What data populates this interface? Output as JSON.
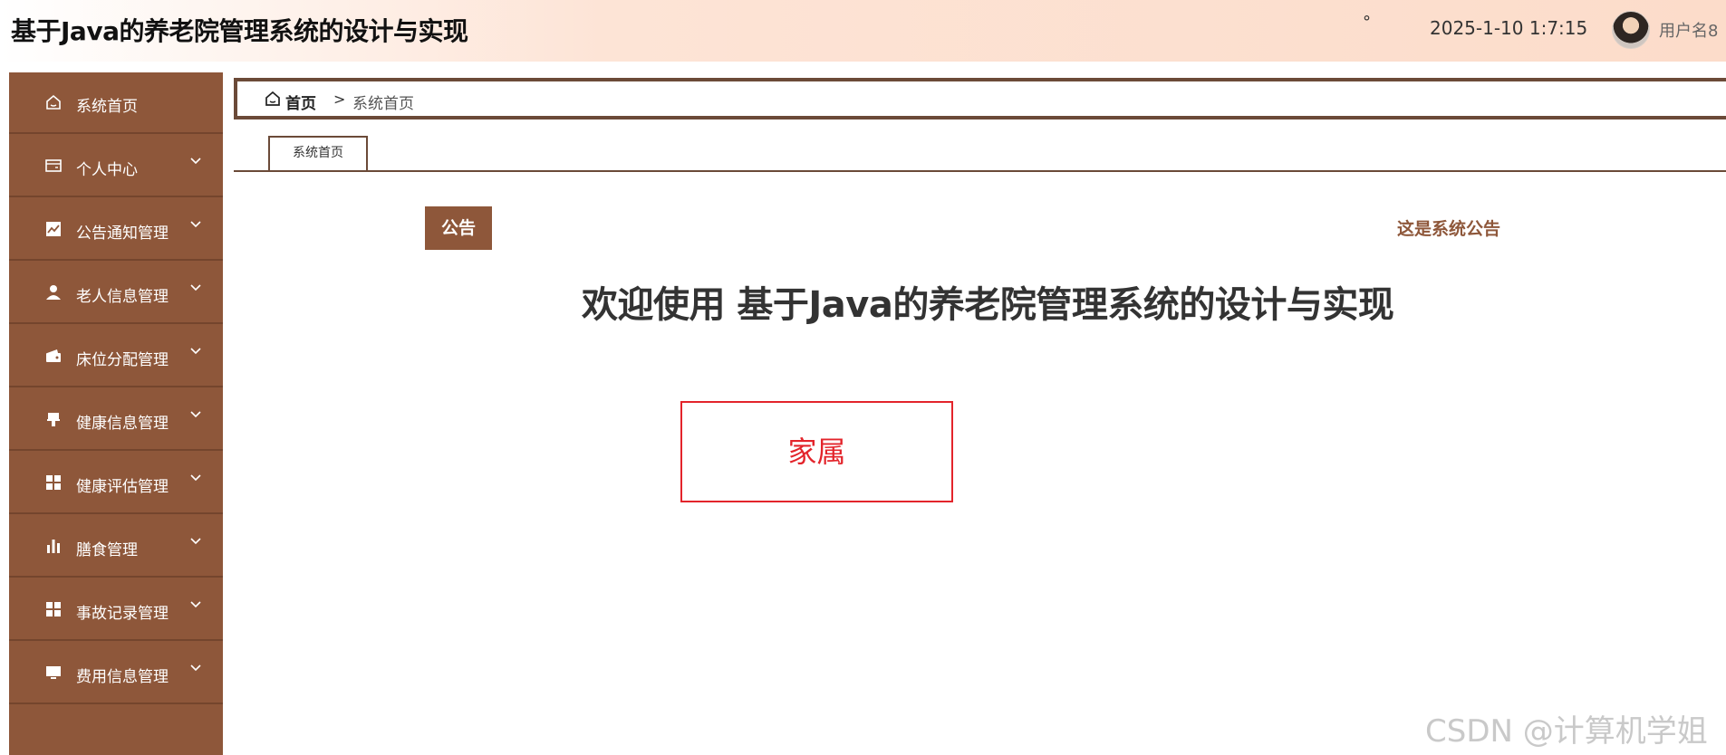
{
  "header": {
    "app_title": "基于Java的养老院管理系统的设计与实现",
    "degree_text": "°",
    "datetime": "2025-1-10 1:7:15",
    "username": "用户名8"
  },
  "sidebar": {
    "items": [
      {
        "label": "系统首页",
        "icon": "home-icon",
        "has_submenu": false
      },
      {
        "label": "个人中心",
        "icon": "card-icon",
        "has_submenu": true
      },
      {
        "label": "公告通知管理",
        "icon": "trend-chart-icon",
        "has_submenu": true
      },
      {
        "label": "老人信息管理",
        "icon": "user-icon",
        "has_submenu": true
      },
      {
        "label": "床位分配管理",
        "icon": "wallet-icon",
        "has_submenu": true
      },
      {
        "label": "健康信息管理",
        "icon": "brush-icon",
        "has_submenu": true
      },
      {
        "label": "健康评估管理",
        "icon": "grid-icon",
        "has_submenu": true
      },
      {
        "label": "膳食管理",
        "icon": "bar-chart-icon",
        "has_submenu": true
      },
      {
        "label": "事故记录管理",
        "icon": "grid-icon",
        "has_submenu": true
      },
      {
        "label": "费用信息管理",
        "icon": "monitor-icon",
        "has_submenu": true
      }
    ]
  },
  "breadcrumb": {
    "home": "首页",
    "separator": ">",
    "current": "系统首页"
  },
  "tabs": [
    {
      "label": "系统首页"
    }
  ],
  "notice": {
    "badge": "公告",
    "text": "这是系统公告"
  },
  "welcome": "欢迎使用 基于Java的养老院管理系统的设计与实现",
  "role_label": "家属",
  "watermark": "CSDN @计算机学姐",
  "colors": {
    "sidebar_bg": "#8e573a",
    "accent": "#6b4a38",
    "role_border": "#e3242b"
  }
}
